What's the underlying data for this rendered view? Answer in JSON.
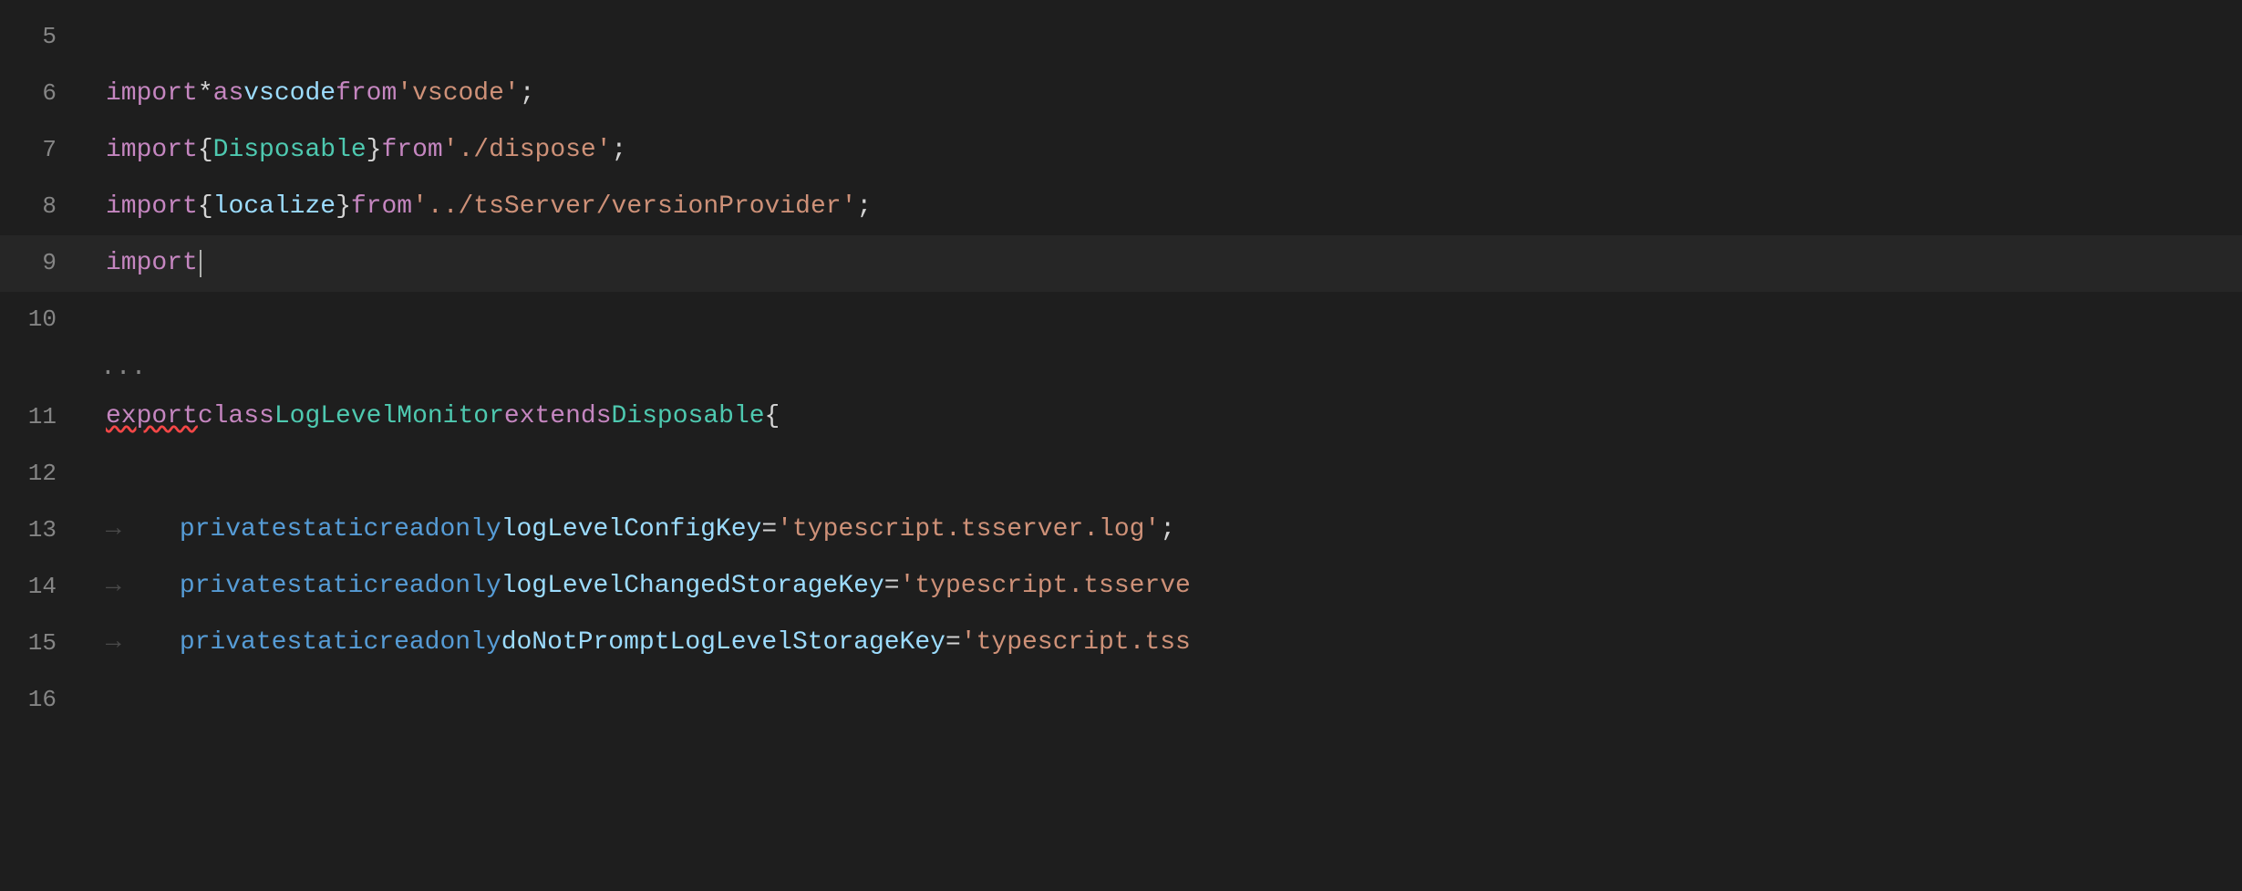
{
  "editor": {
    "background": "#1e1e1e",
    "lines": [
      {
        "number": "5",
        "active": false,
        "content": []
      },
      {
        "number": "6",
        "active": false,
        "content": [
          {
            "type": "kw-import",
            "text": "import"
          },
          {
            "type": "punct",
            "text": " "
          },
          {
            "type": "star-op",
            "text": "*"
          },
          {
            "type": "punct",
            "text": " "
          },
          {
            "type": "kw-as",
            "text": "as"
          },
          {
            "type": "punct",
            "text": " "
          },
          {
            "type": "ns-vscode",
            "text": "vscode"
          },
          {
            "type": "punct",
            "text": " "
          },
          {
            "type": "kw-from",
            "text": "from"
          },
          {
            "type": "punct",
            "text": " "
          },
          {
            "type": "str",
            "text": "'vscode'"
          },
          {
            "type": "punct",
            "text": ";"
          }
        ]
      },
      {
        "number": "7",
        "active": false,
        "content": [
          {
            "type": "kw-import",
            "text": "import"
          },
          {
            "type": "punct",
            "text": " "
          },
          {
            "type": "punct",
            "text": "{"
          },
          {
            "type": "punct",
            "text": " "
          },
          {
            "type": "cls-disposable",
            "text": "Disposable"
          },
          {
            "type": "punct",
            "text": " "
          },
          {
            "type": "punct",
            "text": "}"
          },
          {
            "type": "punct",
            "text": " "
          },
          {
            "type": "kw-from",
            "text": "from"
          },
          {
            "type": "punct",
            "text": " "
          },
          {
            "type": "str",
            "text": "'./dispose'"
          },
          {
            "type": "punct",
            "text": ";"
          }
        ]
      },
      {
        "number": "8",
        "active": false,
        "content": [
          {
            "type": "kw-import",
            "text": "import"
          },
          {
            "type": "punct",
            "text": " "
          },
          {
            "type": "punct",
            "text": "{"
          },
          {
            "type": "punct",
            "text": " "
          },
          {
            "type": "ns-vscode",
            "text": "localize"
          },
          {
            "type": "punct",
            "text": " "
          },
          {
            "type": "punct",
            "text": "}"
          },
          {
            "type": "punct",
            "text": " "
          },
          {
            "type": "kw-from",
            "text": "from"
          },
          {
            "type": "punct",
            "text": " "
          },
          {
            "type": "str",
            "text": "'../tsServer/versionProvider'"
          },
          {
            "type": "punct",
            "text": ";"
          }
        ]
      },
      {
        "number": "9",
        "active": true,
        "content": [
          {
            "type": "kw-import",
            "text": "import"
          },
          {
            "type": "cursor",
            "text": ""
          }
        ]
      },
      {
        "number": "10",
        "active": false,
        "content": []
      },
      {
        "number": "ellipsis",
        "active": false,
        "content": "ellipsis"
      },
      {
        "number": "11",
        "active": false,
        "content": [
          {
            "type": "kw-export",
            "text": "export",
            "squiggle": true
          },
          {
            "type": "punct",
            "text": " "
          },
          {
            "type": "kw-class",
            "text": "class"
          },
          {
            "type": "punct",
            "text": " "
          },
          {
            "type": "cls-name",
            "text": "LogLevelMonitor"
          },
          {
            "type": "punct",
            "text": " "
          },
          {
            "type": "kw-extends",
            "text": "extends"
          },
          {
            "type": "punct",
            "text": " "
          },
          {
            "type": "cls-disposable",
            "text": "Disposable"
          },
          {
            "type": "punct",
            "text": " "
          },
          {
            "type": "punct",
            "text": "{"
          }
        ]
      },
      {
        "number": "12",
        "active": false,
        "content": []
      },
      {
        "number": "13",
        "active": false,
        "tab": true,
        "content": [
          {
            "type": "kw-private",
            "text": "private"
          },
          {
            "type": "punct",
            "text": " "
          },
          {
            "type": "kw-static",
            "text": "static"
          },
          {
            "type": "punct",
            "text": " "
          },
          {
            "type": "kw-readonly",
            "text": "readonly"
          },
          {
            "type": "punct",
            "text": " "
          },
          {
            "type": "prop-name",
            "text": "logLevelConfigKey"
          },
          {
            "type": "punct",
            "text": " "
          },
          {
            "type": "op",
            "text": "="
          },
          {
            "type": "punct",
            "text": " "
          },
          {
            "type": "str",
            "text": "'typescript.tsserver.log'"
          },
          {
            "type": "punct",
            "text": ";"
          }
        ]
      },
      {
        "number": "14",
        "active": false,
        "tab": true,
        "content": [
          {
            "type": "kw-private",
            "text": "private"
          },
          {
            "type": "punct",
            "text": " "
          },
          {
            "type": "kw-static",
            "text": "static"
          },
          {
            "type": "punct",
            "text": " "
          },
          {
            "type": "kw-readonly",
            "text": "readonly"
          },
          {
            "type": "punct",
            "text": " "
          },
          {
            "type": "prop-name",
            "text": "logLevelChangedStorageKey"
          },
          {
            "type": "punct",
            "text": " "
          },
          {
            "type": "op",
            "text": "="
          },
          {
            "type": "punct",
            "text": " "
          },
          {
            "type": "str",
            "text": "'typescript.tsserve"
          }
        ]
      },
      {
        "number": "15",
        "active": false,
        "tab": true,
        "content": [
          {
            "type": "kw-private",
            "text": "private"
          },
          {
            "type": "punct",
            "text": " "
          },
          {
            "type": "kw-static",
            "text": "static"
          },
          {
            "type": "punct",
            "text": " "
          },
          {
            "type": "kw-readonly",
            "text": "readonly"
          },
          {
            "type": "punct",
            "text": " "
          },
          {
            "type": "prop-name",
            "text": "doNotPromptLogLevelStorageKey"
          },
          {
            "type": "punct",
            "text": " "
          },
          {
            "type": "op",
            "text": "="
          },
          {
            "type": "punct",
            "text": " "
          },
          {
            "type": "str",
            "text": "'typescript.tss"
          }
        ]
      },
      {
        "number": "16",
        "active": false,
        "content": []
      }
    ]
  }
}
